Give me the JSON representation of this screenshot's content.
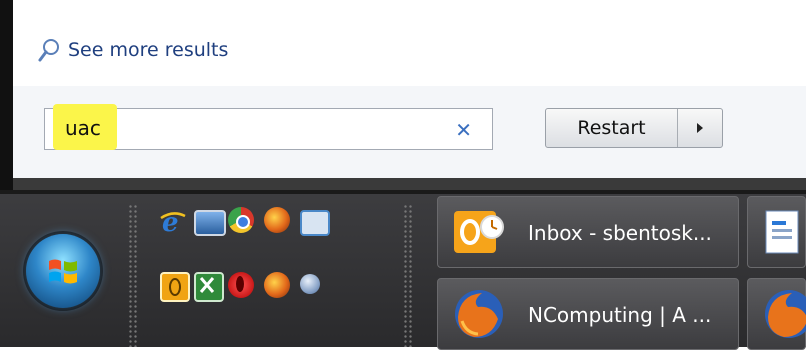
{
  "start_menu": {
    "see_more_results": "See more results",
    "search": {
      "value": "uac"
    },
    "shutdown_button": {
      "label": "Restart"
    }
  },
  "taskbar": {
    "quick_launch": [
      {
        "name": "internet-explorer-icon",
        "color": "#2e7bd6"
      },
      {
        "name": "desktop-icon",
        "color": "#3a78c8"
      },
      {
        "name": "chrome-icon",
        "color": "#e8c11c"
      },
      {
        "name": "firefox-icon",
        "color": "#e8731b"
      },
      {
        "name": "window-switcher-icon",
        "color": "#4a88c8"
      },
      {
        "name": "outlook-icon",
        "color": "#f0a413"
      },
      {
        "name": "excel-icon",
        "color": "#2f8a3a"
      },
      {
        "name": "opera-icon",
        "color": "#d11a1a"
      },
      {
        "name": "firefox-icon-2",
        "color": "#e8731b"
      },
      {
        "name": "network-icon",
        "color": "#8aa4c8"
      }
    ],
    "tasks": [
      {
        "label": "Inbox - sbentosk...",
        "icon": "outlook-icon"
      },
      {
        "label": "NComputing | A ...",
        "icon": "firefox-icon"
      }
    ]
  }
}
